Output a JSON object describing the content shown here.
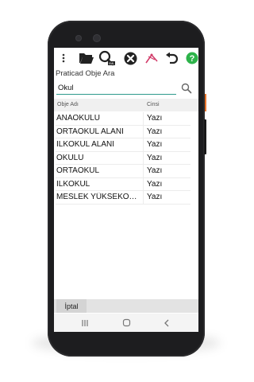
{
  "toolbar": {
    "icons": [
      "more-vert-icon",
      "folder-open-icon",
      "search-xml-icon",
      "close-circle-icon",
      "draw-path-icon",
      "undo-icon",
      "help-icon"
    ]
  },
  "search": {
    "title": "Praticad Obje Ara",
    "query": "Okul"
  },
  "table": {
    "columns": [
      "Obje Adı",
      "Cinsi"
    ],
    "rows": [
      {
        "name": "ANAOKULU",
        "type": "Yazı"
      },
      {
        "name": "ORTAOKUL ALANI",
        "type": "Yazı"
      },
      {
        "name": "İLKOKUL ALANI",
        "type": "Yazı"
      },
      {
        "name": "OKULU",
        "type": "Yazı"
      },
      {
        "name": "ORTAOKUL",
        "type": "Yazı"
      },
      {
        "name": "İLKOKUL",
        "type": "Yazı"
      },
      {
        "name": "MESLEK YÜKSEKOKULU",
        "type": "Yazı"
      }
    ]
  },
  "footer": {
    "cancel_label": "İptal"
  },
  "colors": {
    "accent": "#2e9a8c",
    "help": "#2db34a",
    "draw": "#d23c6a"
  }
}
